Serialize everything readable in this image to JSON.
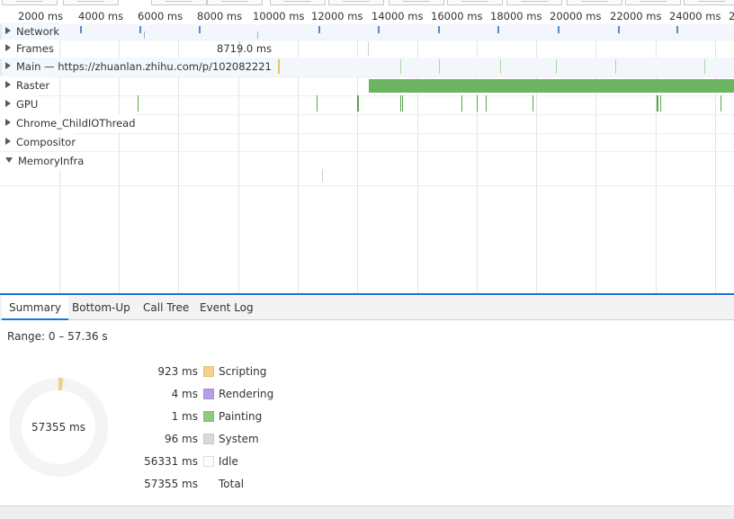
{
  "ruler": {
    "ticks": [
      "2000 ms",
      "4000 ms",
      "6000 ms",
      "8000 ms",
      "10000 ms",
      "12000 ms",
      "14000 ms",
      "16000 ms",
      "18000 ms",
      "20000 ms",
      "22000 ms",
      "24000 ms",
      "2"
    ]
  },
  "tracks": {
    "network": "Network",
    "frames": "Frames",
    "frames_duration": "8719.0 ms",
    "main": "Main — https://zhuanlan.zhihu.com/p/102082221",
    "raster": "Raster",
    "gpu": "GPU",
    "child_io": "Chrome_ChildIOThread",
    "compositor": "Compositor",
    "memory": "MemoryInfra"
  },
  "tabs": {
    "summary": "Summary",
    "bottom_up": "Bottom-Up",
    "call_tree": "Call Tree",
    "event_log": "Event Log"
  },
  "summary": {
    "range": "Range: 0 – 57.36 s",
    "total_center": "57355 ms",
    "items": [
      {
        "value": "923 ms",
        "name": "Scripting",
        "color": "#f2d388"
      },
      {
        "value": "4 ms",
        "name": "Rendering",
        "color": "#b59ee6"
      },
      {
        "value": "1 ms",
        "name": "Painting",
        "color": "#8fca7f"
      },
      {
        "value": "96 ms",
        "name": "System",
        "color": "#dadada"
      },
      {
        "value": "56331 ms",
        "name": "Idle",
        "color": "#ffffff"
      },
      {
        "value": "57355 ms",
        "name": "Total",
        "color": ""
      }
    ]
  }
}
